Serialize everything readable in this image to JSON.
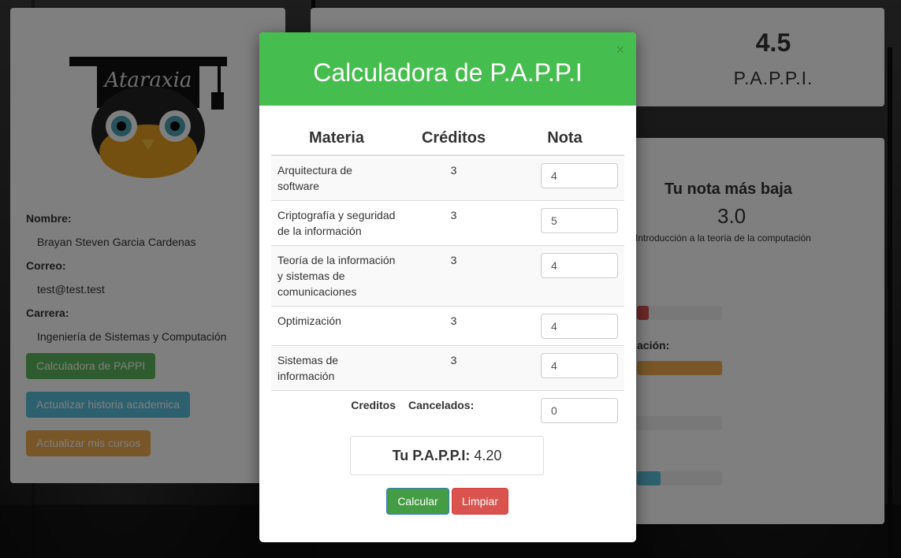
{
  "modal": {
    "title": "Calculadora de P.A.P.P.I",
    "close_label": "×",
    "table": {
      "headers": [
        "Materia",
        "Créditos",
        "Nota"
      ],
      "rows": [
        {
          "subject": "Arquitectura de software",
          "credits": "3",
          "grade": "4"
        },
        {
          "subject": "Criptografía y seguridad de la información",
          "credits": "3",
          "grade": "5"
        },
        {
          "subject": "Teoría de la información y sistemas de comunicaciones",
          "credits": "3",
          "grade": "4"
        },
        {
          "subject": "Optimización",
          "credits": "3",
          "grade": "4"
        },
        {
          "subject": "Sistemas de información",
          "credits": "3",
          "grade": "4"
        }
      ],
      "cancelled_label_1": "Creditos",
      "cancelled_label_2": "Cancelados:",
      "cancelled_value": "0"
    },
    "result_label": "Tu P.A.P.P.I:",
    "result_value": "4.20",
    "calc_button": "Calcular",
    "clear_button": "Limpiar"
  },
  "background_page": {
    "logo_text": "Ataraxia",
    "name_label": "Nombre:",
    "name_value": "Brayan Steven Garcia Cardenas",
    "email_label": "Correo:",
    "email_value": "test@test.test",
    "career_label": "Carrera:",
    "career_value": "Ingeniería de Sistemas y Computación",
    "btn_pappi": "Calculadora de PAPPI",
    "btn_history": "Actualizar historia academica",
    "btn_courses": "Actualizar mis cursos",
    "score_value": "4.5",
    "score_caption": "P.A.P.P.I.",
    "lowest_title": "Tu nota más baja",
    "lowest_value": "3.0",
    "lowest_subject": "Introducción a la teoría de la computación",
    "partial_label": "ación:"
  },
  "colors": {
    "header_green": "#46bd4f",
    "calc_button": "#449d44",
    "clear_button": "#d9534f"
  }
}
